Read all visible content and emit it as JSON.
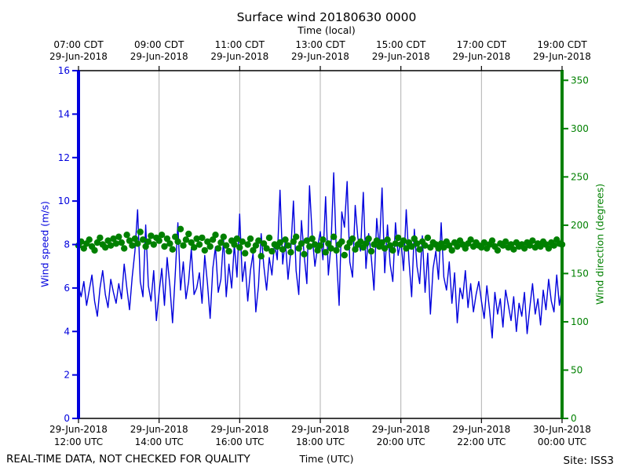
{
  "title": "Surface wind 20180630 0000",
  "top_axis": {
    "label": "Time (local)",
    "ticks": [
      {
        "time": "07:00 CDT",
        "date": "29-Jun-2018"
      },
      {
        "time": "09:00 CDT",
        "date": "29-Jun-2018"
      },
      {
        "time": "11:00 CDT",
        "date": "29-Jun-2018"
      },
      {
        "time": "13:00 CDT",
        "date": "29-Jun-2018"
      },
      {
        "time": "15:00 CDT",
        "date": "29-Jun-2018"
      },
      {
        "time": "17:00 CDT",
        "date": "29-Jun-2018"
      },
      {
        "time": "19:00 CDT",
        "date": "29-Jun-2018"
      }
    ]
  },
  "bottom_axis": {
    "ticks": [
      {
        "date": "29-Jun-2018",
        "time": "12:00 UTC"
      },
      {
        "date": "29-Jun-2018",
        "time": "14:00 UTC"
      },
      {
        "date": "29-Jun-2018",
        "time": "16:00 UTC"
      },
      {
        "date": "29-Jun-2018",
        "time": "18:00 UTC"
      },
      {
        "date": "29-Jun-2018",
        "time": "20:00 UTC"
      },
      {
        "date": "29-Jun-2018",
        "time": "22:00 UTC"
      },
      {
        "date": "30-Jun-2018",
        "time": "00:00 UTC"
      }
    ]
  },
  "left_axis": {
    "label": "Wind speed (m/s)",
    "color": "#0000dd",
    "ticks": [
      0,
      2,
      4,
      6,
      8,
      10,
      12,
      14,
      16
    ]
  },
  "right_axis": {
    "label": "Wind direction (degrees)",
    "color": "#008000",
    "ticks": [
      0,
      50,
      100,
      150,
      200,
      250,
      300,
      350
    ]
  },
  "footer": {
    "disclaimer": "REAL-TIME DATA, NOT CHECKED FOR QUALITY",
    "xlabel": "Time (UTC)",
    "site": "Site: ISS3"
  },
  "colors": {
    "speed": "#0000dd",
    "direction": "#008000",
    "grid": "#b0b0b0",
    "frame": "#000000"
  },
  "chart_data": {
    "type": "line",
    "title": "Surface wind 20180630 0000",
    "xlabel": "Time (UTC)",
    "x_axis_top_label": "Time (local)",
    "ylabel_left": "Wind speed (m/s)",
    "ylabel_right": "Wind direction (degrees)",
    "left_ylim": [
      0,
      16
    ],
    "right_ylim": [
      0,
      360
    ],
    "x_total_minutes": 720,
    "x_tick_minutes": [
      0,
      120,
      240,
      360,
      480,
      600,
      720
    ],
    "x_minutes": {
      "start": 0,
      "step": 4,
      "count": 181
    },
    "grid": "vertical-only",
    "legend": "none",
    "series": [
      {
        "name": "Wind speed (m/s)",
        "axis": "left",
        "style": "line",
        "values": [
          6.1,
          5.6,
          6.3,
          5.2,
          5.9,
          6.6,
          5.4,
          4.7,
          6.0,
          6.8,
          5.7,
          5.1,
          6.4,
          5.8,
          5.3,
          6.2,
          5.5,
          7.1,
          6.0,
          5.0,
          6.5,
          7.7,
          9.6,
          6.3,
          5.6,
          8.9,
          6.1,
          5.4,
          6.8,
          4.5,
          5.8,
          6.9,
          5.2,
          7.4,
          6.1,
          4.4,
          6.6,
          9.0,
          5.9,
          7.2,
          5.5,
          6.3,
          7.8,
          5.7,
          6.0,
          6.7,
          5.3,
          7.5,
          6.2,
          4.6,
          6.9,
          7.9,
          5.8,
          6.4,
          8.3,
          5.6,
          7.1,
          6.0,
          8.0,
          6.5,
          9.4,
          6.3,
          7.2,
          5.4,
          6.8,
          7.6,
          4.9,
          6.1,
          8.5,
          7.0,
          5.9,
          7.4,
          6.6,
          8.1,
          7.3,
          10.5,
          7.1,
          8.2,
          6.4,
          7.7,
          10.0,
          6.8,
          5.7,
          9.1,
          7.5,
          6.2,
          10.7,
          8.4,
          7.0,
          7.9,
          8.6,
          7.3,
          10.2,
          6.6,
          8.0,
          11.3,
          7.6,
          5.2,
          9.5,
          8.8,
          10.9,
          7.2,
          6.5,
          9.8,
          8.3,
          7.7,
          10.4,
          6.9,
          8.5,
          7.4,
          5.9,
          9.2,
          7.8,
          10.6,
          6.7,
          8.9,
          7.1,
          6.3,
          9.0,
          7.5,
          8.2,
          6.8,
          9.6,
          7.3,
          5.6,
          8.7,
          7.0,
          6.2,
          8.4,
          5.8,
          7.6,
          4.8,
          6.9,
          7.7,
          6.4,
          9.0,
          6.5,
          5.9,
          7.2,
          5.3,
          6.7,
          4.4,
          6.0,
          5.5,
          6.8,
          5.1,
          6.2,
          4.9,
          5.7,
          6.3,
          5.4,
          4.6,
          6.1,
          5.0,
          3.7,
          5.8,
          4.8,
          5.5,
          4.2,
          5.9,
          5.2,
          4.5,
          5.6,
          4.0,
          5.3,
          4.7,
          5.8,
          3.9,
          5.1,
          6.2,
          4.8,
          5.5,
          4.3,
          5.9,
          5.0,
          6.4,
          5.4,
          4.9,
          6.6,
          5.2,
          6.0
        ]
      },
      {
        "name": "Wind direction (degrees)",
        "axis": "right",
        "style": "scatter",
        "values": [
          179,
          183,
          176,
          181,
          185,
          178,
          174,
          182,
          187,
          180,
          177,
          184,
          179,
          186,
          181,
          188,
          182,
          176,
          190,
          184,
          179,
          186,
          181,
          193,
          185,
          178,
          183,
          189,
          180,
          187,
          184,
          190,
          178,
          186,
          181,
          175,
          188,
          183,
          196,
          179,
          185,
          191,
          182,
          177,
          186,
          180,
          187,
          174,
          183,
          178,
          185,
          190,
          176,
          182,
          188,
          179,
          173,
          184,
          180,
          186,
          177,
          183,
          171,
          180,
          186,
          174,
          179,
          184,
          168,
          181,
          176,
          187,
          173,
          180,
          178,
          182,
          175,
          185,
          179,
          172,
          183,
          188,
          176,
          181,
          170,
          184,
          178,
          186,
          180,
          174,
          179,
          185,
          172,
          181,
          176,
          188,
          174,
          180,
          183,
          169,
          177,
          182,
          186,
          175,
          180,
          183,
          177,
          181,
          186,
          173,
          180,
          184,
          178,
          182,
          176,
          185,
          179,
          174,
          181,
          187,
          180,
          184,
          176,
          182,
          178,
          186,
          181,
          175,
          183,
          179,
          187,
          177,
          182,
          180,
          176,
          181,
          177,
          183,
          179,
          174,
          182,
          178,
          184,
          180,
          176,
          181,
          185,
          178,
          182,
          179,
          177,
          182,
          176,
          180,
          184,
          178,
          174,
          181,
          179,
          183,
          177,
          180,
          175,
          182,
          178,
          180,
          176,
          182,
          179,
          184,
          177,
          181,
          178,
          183,
          180,
          176,
          182,
          179,
          185,
          181,
          180
        ]
      }
    ]
  }
}
